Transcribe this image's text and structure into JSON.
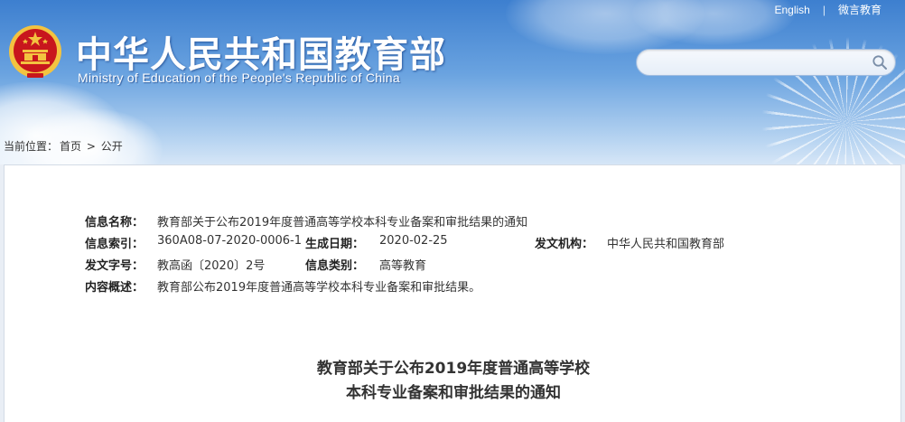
{
  "header": {
    "title_cn": "中华人民共和国教育部",
    "title_en": "Ministry of Education of the People's Republic of China",
    "links": {
      "english": "English",
      "weibo": "微言教育",
      "separator": "|"
    },
    "search": {
      "placeholder": ""
    }
  },
  "breadcrumb": {
    "label": "当前位置：",
    "home": "首页",
    "sep": ">",
    "current": "公开"
  },
  "meta": {
    "name_label": "信息名称：",
    "name_value": "教育部关于公布2019年度普通高等学校本科专业备案和审批结果的通知",
    "index_label": "信息索引：",
    "index_value": "360A08-07-2020-0006-1",
    "date_label": "生成日期：",
    "date_value": "2020-02-25",
    "issuer_label": "发文机构：",
    "issuer_value": "中华人民共和国教育部",
    "docno_label": "发文字号：",
    "docno_value": "教高函〔2020〕2号",
    "category_label": "信息类别：",
    "category_value": "高等教育",
    "summary_label": "内容概述：",
    "summary_value": "教育部公布2019年度普通高等学校本科专业备案和审批结果。"
  },
  "article": {
    "title_line1": "教育部关于公布2019年度普通高等学校",
    "title_line2": "本科专业备案和审批结果的通知"
  },
  "colors": {
    "header_top": "#3d7fcf",
    "header_bottom": "#d6e6f7",
    "emblem_red": "#c8161d",
    "emblem_gold": "#f3c340"
  },
  "icons": {
    "emblem": "national-emblem-icon",
    "search": "search-icon"
  }
}
